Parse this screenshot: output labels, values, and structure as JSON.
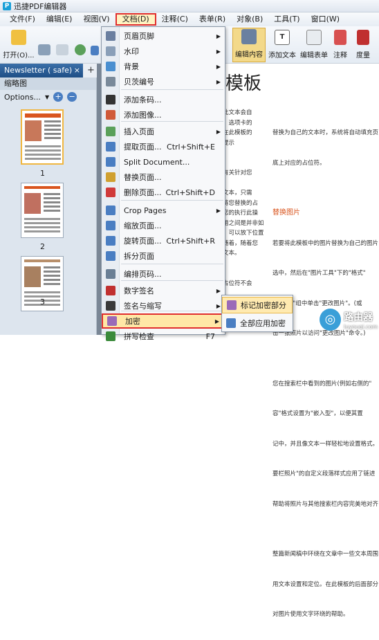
{
  "app": {
    "title": "迅捷PDF编辑器",
    "logo_letter": "P"
  },
  "menubar": [
    "文件(F)",
    "编辑(E)",
    "视图(V)",
    "文档(D)",
    "注释(C)",
    "表单(R)",
    "对象(B)",
    "工具(T)",
    "窗口(W)"
  ],
  "toolbar": {
    "open": "打开(O)...",
    "edit_content": "编辑内容",
    "add_text": "添加文本",
    "edit_form": "编辑表单",
    "annotate": "注释",
    "measure": "度量"
  },
  "tab": {
    "label": "Newsletter ( safe)",
    "close": "×",
    "add": "+"
  },
  "sidebar": {
    "title": "缩略图",
    "options": "Options...",
    "pages": [
      "1",
      "2",
      "3"
    ]
  },
  "document": {
    "heading": "模板",
    "col_a": "此文本会自\n，选项卡的\n在此模板的\n提示\n\n\n有关针对您\n\n文本，只需\n将您替换的占\n您的执行此操\n用之间是并非如\n，可以放下位置\n随着，随着您\n文本。\n\n\n占位符不会\n",
    "col_b": [
      "替换为自己的文本时，系统将自动填充页",
      "底上对应的占位符。",
      "",
      "替换图片",
      "若要将此模板中的图片替换为自己的图片",
      "选中，然后在\"图片工具\"下的\"格式\"",
      "在\"调整\"组中单击\"更改图片\"。(或",
      "击一张照片以访问\"更改图片\"命令。)",
      "",
      "您在搜索栏中看到的图片(例如右侧的\"",
      "容\"格式设置为\"嵌入型\"，以便其置",
      "记中，并且像文本一样轻松地设置格式。",
      "要栏照片\"的自定义段落样式应用了链进",
      "帮助将照片与其他搜索栏内容完美地对齐",
      "",
      "整篇新闻稿中环绕在文章中一些文本周围",
      "用文本设置和定位。在此模板的后面部分",
      "对图片使用文字环绕的帮助。"
    ]
  },
  "doc_menu": [
    {
      "label": "页眉页脚",
      "shortcut": "",
      "arrow": true,
      "color": "#6a7fa0"
    },
    {
      "label": "水印",
      "shortcut": "",
      "arrow": true,
      "color": "#8a9fb8"
    },
    {
      "label": "背景",
      "shortcut": "",
      "arrow": true,
      "color": "#4a8fd0"
    },
    {
      "label": "贝茨编号",
      "shortcut": "",
      "arrow": true,
      "color": "#7a8a9a"
    },
    {
      "label": "添加条码...",
      "shortcut": "",
      "arrow": false,
      "color": "#333333"
    },
    {
      "label": "添加图像...",
      "shortcut": "",
      "arrow": false,
      "color": "#d05a3a"
    },
    {
      "label": "插入页面",
      "shortcut": "",
      "arrow": true,
      "color": "#5aa05a"
    },
    {
      "label": "提取页面...",
      "shortcut": "Ctrl+Shift+E",
      "arrow": false,
      "color": "#4a7ec2"
    },
    {
      "label": "Split Document...",
      "shortcut": "",
      "arrow": false,
      "color": "#4a7ec2"
    },
    {
      "label": "替换页面...",
      "shortcut": "",
      "arrow": false,
      "color": "#d0a030"
    },
    {
      "label": "删除页面...",
      "shortcut": "Ctrl+Shift+D",
      "arrow": false,
      "color": "#d03a3a"
    },
    {
      "label": "Crop Pages",
      "shortcut": "",
      "arrow": true,
      "color": "#4a7ec2"
    },
    {
      "label": "缩放页面...",
      "shortcut": "",
      "arrow": false,
      "color": "#4a7ec2"
    },
    {
      "label": "旋转页面...",
      "shortcut": "Ctrl+Shift+R",
      "arrow": false,
      "color": "#4a7ec2"
    },
    {
      "label": "拆分页面",
      "shortcut": "",
      "arrow": false,
      "color": "#4a7ec2"
    },
    {
      "label": "编排页码...",
      "shortcut": "",
      "arrow": false,
      "color": "#6a7f95"
    },
    {
      "label": "数字签名",
      "shortcut": "",
      "arrow": true,
      "color": "#c03030"
    },
    {
      "label": "签名与缩写",
      "shortcut": "",
      "arrow": true,
      "color": "#3a3a3a"
    },
    {
      "label": "加密",
      "shortcut": "",
      "arrow": true,
      "color": "#9a6ab8"
    },
    {
      "label": "拼写检查",
      "shortcut": "F7",
      "arrow": false,
      "color": "#3a8a3a"
    }
  ],
  "encrypt_submenu": [
    "标记加密部分",
    "全部应用加密"
  ],
  "watermark": {
    "name": "路由器",
    "url": "luyouqi.com"
  }
}
